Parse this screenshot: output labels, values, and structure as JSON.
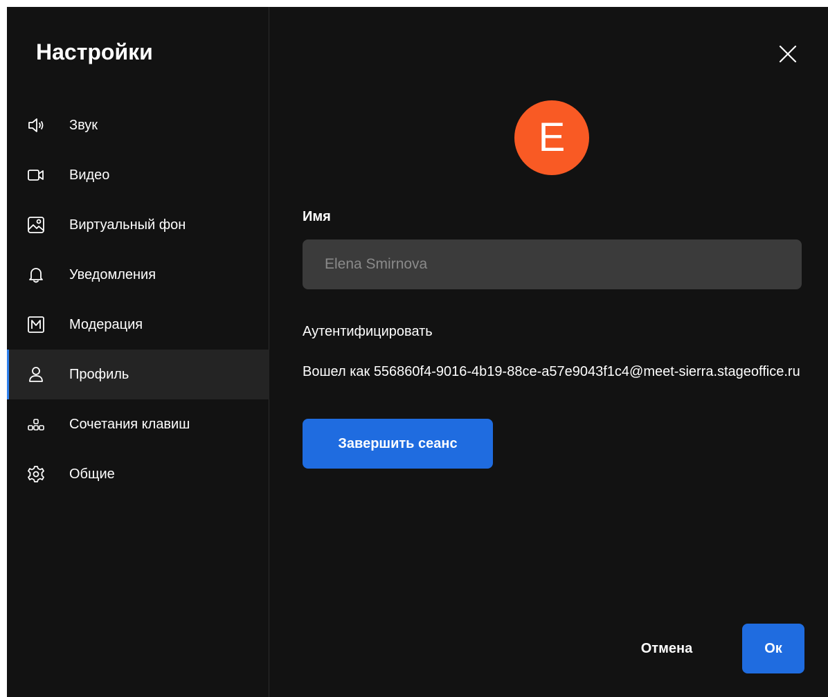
{
  "sidebar": {
    "title": "Настройки",
    "items": [
      {
        "label": "Звук",
        "icon": "speaker-icon"
      },
      {
        "label": "Видео",
        "icon": "video-camera-icon"
      },
      {
        "label": "Виртуальный фон",
        "icon": "image-icon"
      },
      {
        "label": "Уведомления",
        "icon": "bell-icon"
      },
      {
        "label": "Модерация",
        "icon": "moderation-icon"
      },
      {
        "label": "Профиль",
        "icon": "user-icon",
        "active": true
      },
      {
        "label": "Сочетания клавиш",
        "icon": "shortcuts-icon"
      },
      {
        "label": "Общие",
        "icon": "gear-icon"
      }
    ]
  },
  "profile": {
    "avatar_letter": "E",
    "avatar_color": "#f95a24",
    "name_label": "Имя",
    "name_placeholder": "Elena Smirnova",
    "auth_title": "Аутентифицировать",
    "auth_info": "Вошел как 556860f4-9016-4b19-88ce-a57e9043f1c4@meet-sierra.stageoffice.ru",
    "end_session_label": "Завершить сеанс"
  },
  "footer": {
    "cancel_label": "Отмена",
    "ok_label": "Ок"
  },
  "colors": {
    "background": "#121212",
    "accent": "#1f6ce0",
    "active_indicator": "#2f80ed"
  }
}
